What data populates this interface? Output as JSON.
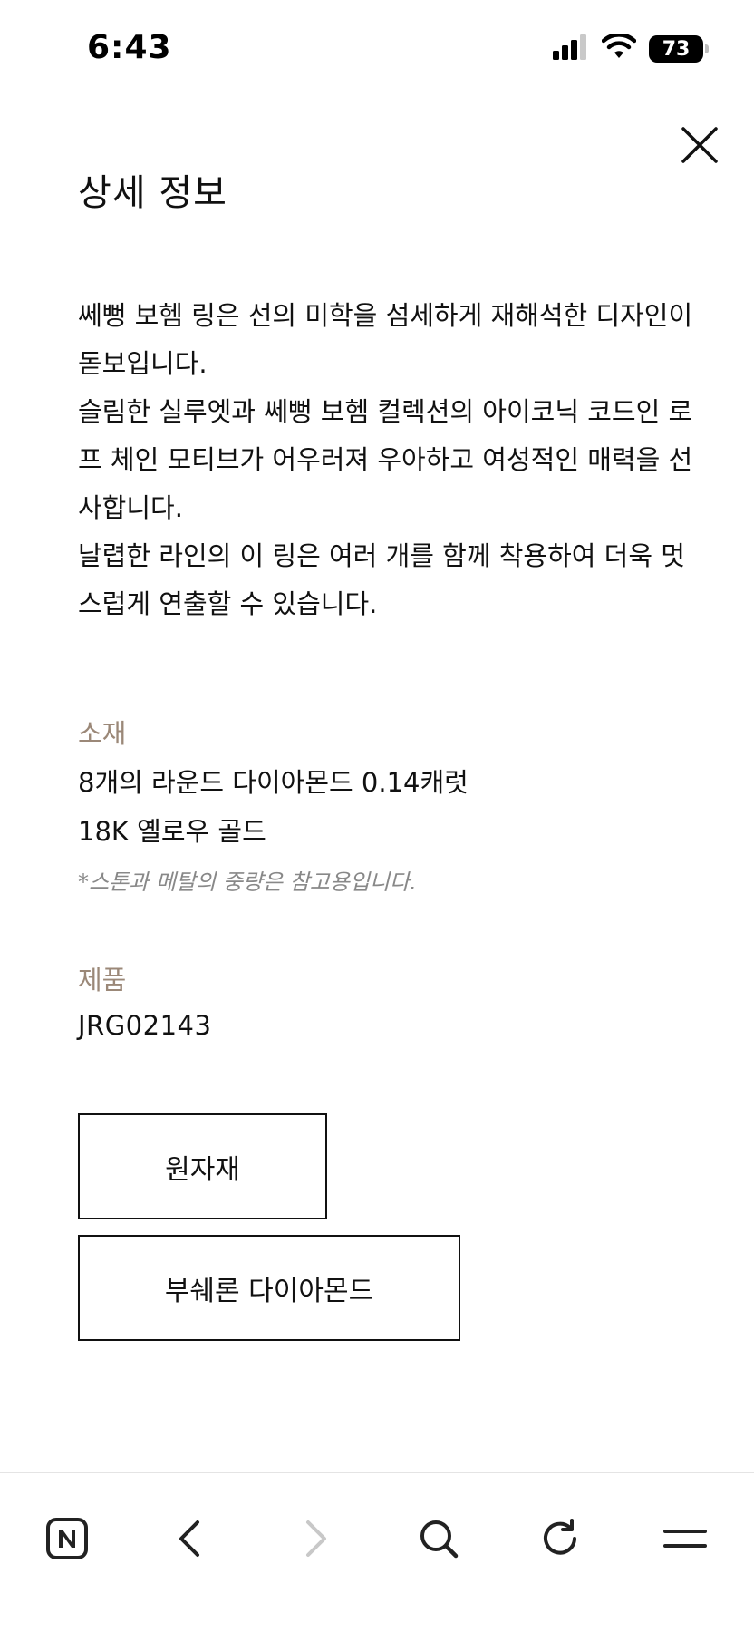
{
  "status_bar": {
    "time": "6:43",
    "battery": "73",
    "icons": [
      "cellular-signal-icon",
      "wifi-icon",
      "battery-icon"
    ]
  },
  "header": {
    "title": "상세 정보",
    "close_icon": "close-icon"
  },
  "description": {
    "paragraphs": [
      "쎄뻥 보헴 링은 선의 미학을 섬세하게 재해석한 디자인이 돋보입니다.",
      "슬림한 실루엣과 쎄뻥 보헴 컬렉션의 아이코닉 코드인 로프 체인 모티브가 어우러져 우아하고 여성적인 매력을 선사합니다.",
      "날렵한 라인의 이 링은 여러 개를 함께 착용하여 더욱 멋스럽게 연출할 수 있습니다."
    ]
  },
  "material": {
    "label": "소재",
    "lines": [
      "8개의 라운드 다이아몬드 0.14캐럿",
      "18K 옐로우 골드"
    ],
    "note": "*스톤과 메탈의 중량은 참고용입니다."
  },
  "product": {
    "label": "제품",
    "code": "JRG02143"
  },
  "buttons": {
    "raw_material": "원자재",
    "boucheron_diamond": "부쉐론 다이아몬드"
  },
  "toolbar": {
    "items": [
      "naver-n-icon",
      "back-icon",
      "forward-icon",
      "search-icon",
      "reload-icon",
      "menu-icon"
    ]
  },
  "colors": {
    "accent_label": "#9b8878",
    "text": "#111111",
    "note": "#888888",
    "disabled_icon": "#c8c8c8"
  }
}
